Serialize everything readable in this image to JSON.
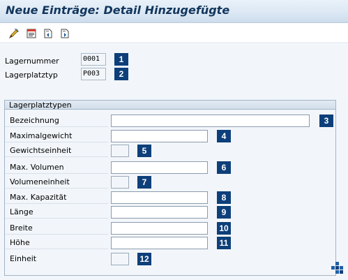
{
  "window": {
    "title": "Neue Einträge: Detail Hinzugefügte"
  },
  "toolbar": {
    "buttons": [
      {
        "name": "display-change-icon"
      },
      {
        "name": "save-local-icon"
      },
      {
        "name": "previous-entry-icon"
      },
      {
        "name": "next-entry-icon"
      }
    ]
  },
  "header_fields": [
    {
      "label": "Lagernummer",
      "value": "0001",
      "marker": "1"
    },
    {
      "label": "Lagerplatztyp",
      "value": "P003",
      "marker": "2"
    }
  ],
  "group": {
    "title": "Lagerplatztypen",
    "fields": [
      {
        "label": "Bezeichnung",
        "value": "",
        "marker": "3"
      },
      {
        "label": "Maximalgewicht",
        "value": "",
        "marker": "4"
      },
      {
        "label": "Gewichtseinheit",
        "value": "",
        "marker": "5"
      },
      {
        "label": "Max. Volumen",
        "value": "",
        "marker": "6"
      },
      {
        "label": "Volumeneinheit",
        "value": "",
        "marker": "7"
      },
      {
        "label": "Max. Kapazität",
        "value": "",
        "marker": "8"
      },
      {
        "label": "Länge",
        "value": "",
        "marker": "9"
      },
      {
        "label": "Breite",
        "value": "",
        "marker": "10"
      },
      {
        "label": "Höhe",
        "value": "",
        "marker": "11"
      },
      {
        "label": "Einheit",
        "value": "",
        "marker": "12"
      }
    ]
  },
  "colors": {
    "title": "#12365d",
    "badge": "#0d3f7a",
    "content_bg": "#f2f6fa"
  }
}
